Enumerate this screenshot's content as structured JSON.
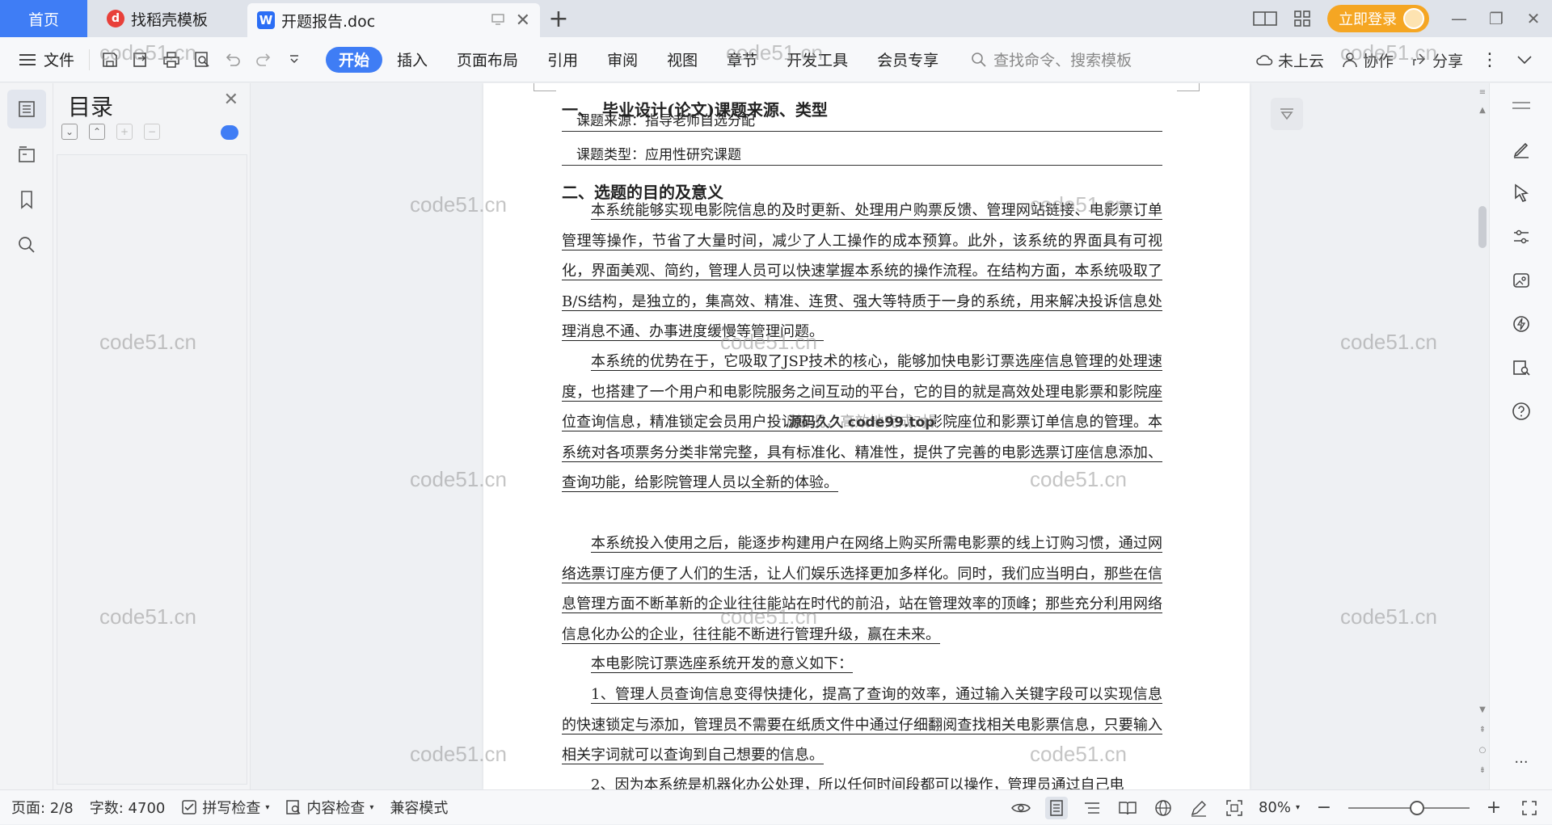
{
  "tabs": {
    "home": "首页",
    "templates": "找稻壳模板",
    "document": "开题报告.doc"
  },
  "titlebar": {
    "login": "立即登录"
  },
  "ribbon": {
    "file": "文件",
    "tabs": [
      "开始",
      "插入",
      "页面布局",
      "引用",
      "审阅",
      "视图",
      "章节",
      "开发工具",
      "会员专享"
    ],
    "search_placeholder": "查找命令、搜索模板",
    "cloud": "未上云",
    "collab": "协作",
    "share": "分享"
  },
  "toc": {
    "title": "目录"
  },
  "document": {
    "heading1": "一、　毕业设计(论文)课题来源、类型",
    "source_line": "课题来源：指导老师自选分配",
    "type_line": "课题类型：应用性研究课题",
    "heading2": "二、选题的目的及意义",
    "paragraphs": [
      "本系统能够实现电影院信息的及时更新、处理用户购票反馈、管理网站链接、电影票订单管理等操作，节省了大量时间，减少了人工操作的成本预算。此外，该系统的界面具有可视化，界面美观、简约，管理人员可以快速掌握本系统的操作流程。在结构方面，本系统吸取了B/S结构，是独立的，集高效、精准、连贯、强大等特质于一身的系统，用来解决投诉信息处理消息不通、办事进度缓慢等管理问题。",
      "本系统的优势在于，它吸取了JSP技术的核心，能够加快电影订票选座信息管理的处理速度，也搭建了一个用户和电影院服务之间互动的平台，它的目的就是高效处理电影票和影院座位查询信息，精准锁定会员用户投诉情况，高效地完成对影院座位和影票订单信息的管理。本系统对各项票务分类非常完整，具有标准化、精准性，提供了完善的电影选票订座信息添加、查询功能，给影院管理人员以全新的体验。",
      "本系统投入使用之后，能逐步构建用户在网络上购买所需电影票的线上订购习惯，通过网络选票订座方便了人们的生活，让人们娱乐选择更加多样化。同时，我们应当明白，那些在信息管理方面不断革新的企业往往能站在时代的前沿，站在管理效率的顶峰；那些充分利用网络信息化办公的企业，往往能不断进行管理升级，赢在未来。",
      "本电影院订票选座系统开发的意义如下：",
      "1、管理人员查询信息变得快捷化，提高了查询的效率，通过输入关键字段可以实现信息的快速锁定与添加，管理员不需要在纸质文件中通过仔细翻阅查找相关电影票信息，只要输入相关字词就可以查询到自己想要的信息。",
      "2、因为本系统是机器化办公处理，所以任何时间段都可以操作，管理员通过自己电"
    ],
    "stamp": "源码久久 code99.top"
  },
  "watermark": "code51.cn",
  "statusbar": {
    "page": "页面: 2/8",
    "words": "字数: 4700",
    "spell": "拼写检查",
    "content_check": "内容检查",
    "compat": "兼容模式",
    "zoom": "80%"
  }
}
